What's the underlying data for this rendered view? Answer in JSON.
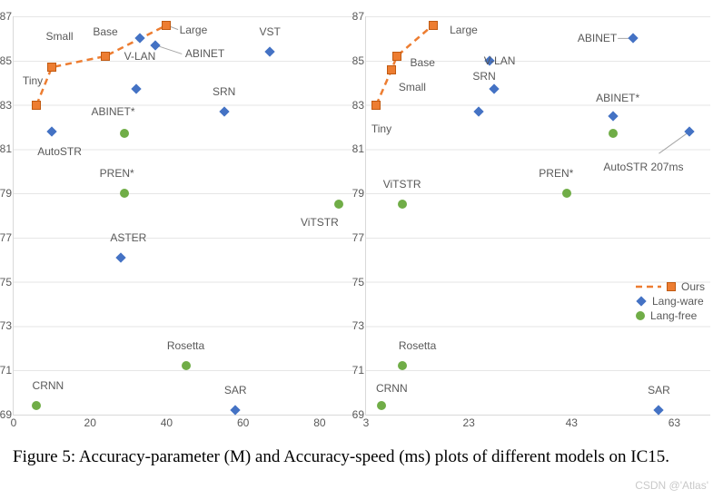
{
  "caption": "Figure 5: Accuracy-parameter (M) and Accuracy-speed (ms) plots of different models on IC15.",
  "watermark": "CSDN @'Atlas'",
  "legend": {
    "ours": "Ours",
    "langware": "Lang-ware",
    "langfree": "Lang-free"
  },
  "chart_data": [
    {
      "type": "scatter",
      "title": "",
      "xlabel": "",
      "ylabel": "",
      "xlim": [
        0,
        90
      ],
      "ylim": [
        69,
        87
      ],
      "xticks": [
        0,
        20,
        40,
        60,
        80
      ],
      "yticks": [
        69,
        71,
        73,
        75,
        77,
        79,
        81,
        83,
        85,
        87
      ],
      "series": [
        {
          "name": "Ours",
          "style": "square-orange-dashed",
          "points": [
            {
              "x": 6,
              "y": 83.0,
              "label": "Tiny",
              "lx": 5,
              "ly": 84.1
            },
            {
              "x": 10,
              "y": 84.7,
              "label": "Small",
              "lx": 12,
              "ly": 86.1
            },
            {
              "x": 24,
              "y": 85.2,
              "label": "Base",
              "lx": 24,
              "ly": 86.3
            },
            {
              "x": 40,
              "y": 86.6,
              "label": "Large",
              "lx": 47,
              "ly": 86.4
            }
          ]
        },
        {
          "name": "Lang-ware",
          "style": "diamond-blue",
          "points": [
            {
              "x": 10,
              "y": 81.8,
              "label": "AutoSTR",
              "lx": 12,
              "ly": 80.9
            },
            {
              "x": 33,
              "y": 86.0,
              "label": "V-LAN",
              "lx": 33,
              "ly": 85.2
            },
            {
              "x": 37,
              "y": 85.7,
              "label": "ABINET",
              "lx": 50,
              "ly": 85.3
            },
            {
              "x": 32,
              "y": 83.7,
              "label": "ABINET*",
              "lx": 26,
              "ly": 82.7
            },
            {
              "x": 55,
              "y": 82.7,
              "label": "SRN",
              "lx": 55,
              "ly": 83.6
            },
            {
              "x": 67,
              "y": 85.4,
              "label": "VST",
              "lx": 67,
              "ly": 86.3
            },
            {
              "x": 28,
              "y": 76.1,
              "label": "ASTER",
              "lx": 30,
              "ly": 77.0
            },
            {
              "x": 58,
              "y": 69.2,
              "label": "SAR",
              "lx": 58,
              "ly": 70.1
            }
          ]
        },
        {
          "name": "Lang-free",
          "style": "circle-green",
          "points": [
            {
              "x": 6,
              "y": 69.4,
              "label": "CRNN",
              "lx": 9,
              "ly": 70.3
            },
            {
              "x": 29,
              "y": 81.7
            },
            {
              "x": 29,
              "y": 79.0,
              "label": "PREN*",
              "lx": 27,
              "ly": 79.9
            },
            {
              "x": 85,
              "y": 78.5,
              "label": "ViTSTR",
              "lx": 80,
              "ly": 77.7
            },
            {
              "x": 45,
              "y": 71.2,
              "label": "Rosetta",
              "lx": 45,
              "ly": 72.1
            }
          ]
        }
      ],
      "leaders": [
        {
          "x1": 37,
          "y1": 85.7,
          "x2": 44,
          "y2": 85.3
        },
        {
          "x1": 40,
          "y1": 86.6,
          "x2": 43,
          "y2": 86.4
        }
      ]
    },
    {
      "type": "scatter",
      "title": "",
      "xlabel": "",
      "ylabel": "",
      "xlim": [
        3,
        70
      ],
      "ylim": [
        69,
        87
      ],
      "xticks": [
        3,
        23,
        43,
        63
      ],
      "yticks": [
        69,
        71,
        73,
        75,
        77,
        79,
        81,
        83,
        85,
        87
      ],
      "series": [
        {
          "name": "Ours",
          "style": "square-orange-dashed",
          "points": [
            {
              "x": 5,
              "y": 83.0,
              "label": "Tiny",
              "lx": 6,
              "ly": 81.9
            },
            {
              "x": 8,
              "y": 84.6,
              "label": "Small",
              "lx": 12,
              "ly": 83.8
            },
            {
              "x": 9,
              "y": 85.2,
              "label": "Base",
              "lx": 14,
              "ly": 84.9
            },
            {
              "x": 16,
              "y": 86.6,
              "label": "Large",
              "lx": 22,
              "ly": 86.4
            }
          ]
        },
        {
          "name": "Lang-ware",
          "style": "diamond-blue",
          "points": [
            {
              "x": 55,
              "y": 86.0,
              "label": "ABINET",
              "lx": 48,
              "ly": 86.0
            },
            {
              "x": 27,
              "y": 85.0,
              "label": "V-LAN",
              "lx": 29,
              "ly": 85.0
            },
            {
              "x": 28,
              "y": 83.7,
              "label": "SRN",
              "lx": 26,
              "ly": 84.3
            },
            {
              "x": 25,
              "y": 82.7
            },
            {
              "x": 51,
              "y": 82.5,
              "label": "ABINET*",
              "lx": 52,
              "ly": 83.3
            },
            {
              "x": 66,
              "y": 81.8,
              "label": "AutoSTR 207ms",
              "lx": 57,
              "ly": 80.2
            },
            {
              "x": 60,
              "y": 69.2,
              "label": "SAR",
              "lx": 60,
              "ly": 70.1
            }
          ]
        },
        {
          "name": "Lang-free",
          "style": "circle-green",
          "points": [
            {
              "x": 6,
              "y": 69.4,
              "label": "CRNN",
              "lx": 8,
              "ly": 70.2
            },
            {
              "x": 10,
              "y": 78.5,
              "label": "ViTSTR",
              "lx": 10,
              "ly": 79.4
            },
            {
              "x": 10,
              "y": 71.2,
              "label": "Rosetta",
              "lx": 13,
              "ly": 72.1
            },
            {
              "x": 42,
              "y": 79.0,
              "label": "PREN*",
              "lx": 40,
              "ly": 79.9
            },
            {
              "x": 51,
              "y": 81.7
            }
          ]
        }
      ],
      "leaders": [
        {
          "x1": 55,
          "y1": 86.0,
          "x2": 52,
          "y2": 86.0
        },
        {
          "x1": 66,
          "y1": 81.8,
          "x2": 60,
          "y2": 80.8
        }
      ]
    }
  ]
}
